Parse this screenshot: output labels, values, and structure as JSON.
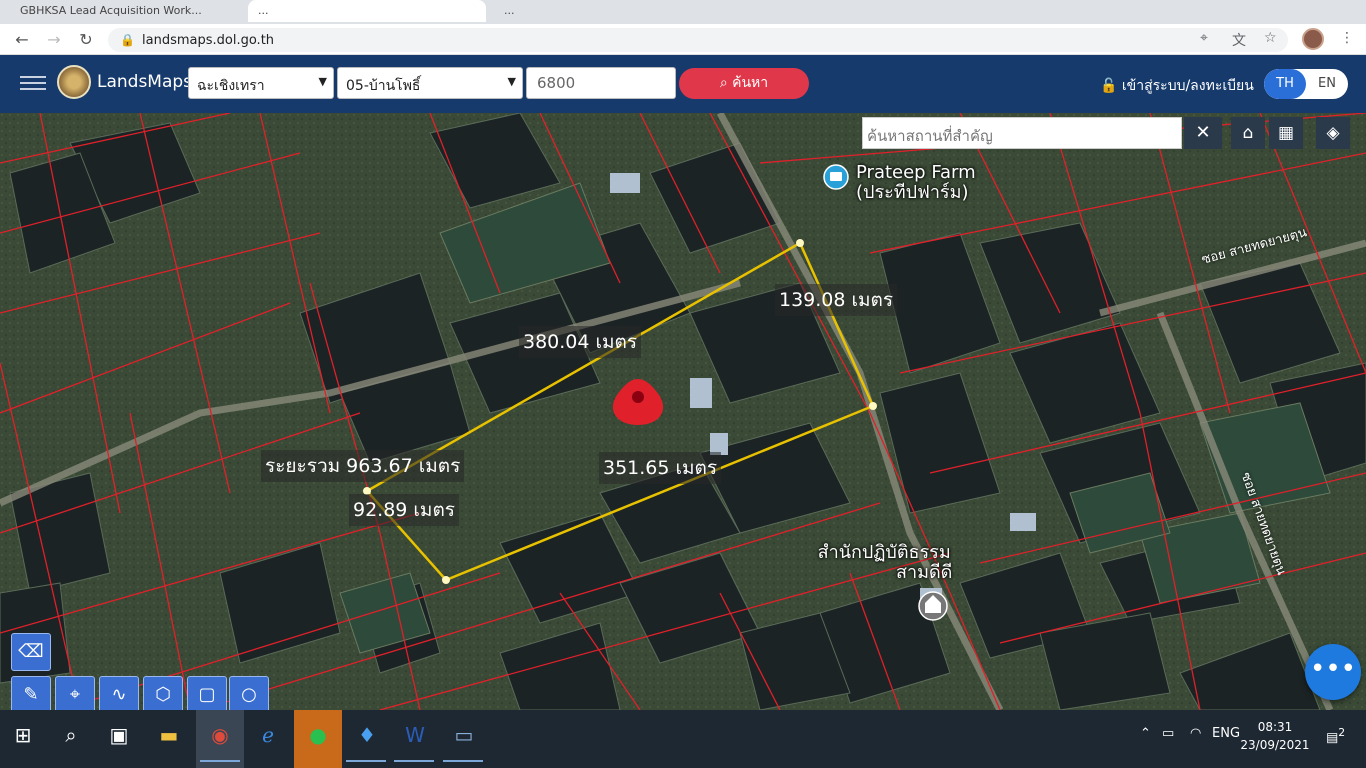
{
  "browser": {
    "url": "landsmaps.dol.go.th",
    "tabs": [
      {
        "label": "GBHKSA Lead Acquisition Work..."
      },
      {
        "label": "..."
      },
      {
        "label": "..."
      }
    ]
  },
  "header": {
    "brand": "LandsMaps",
    "province_select": "ฉะเชิงเทรา",
    "district_select": "05-บ้านโพธิ์",
    "parcel_number": "6800",
    "search_label": "ค้นหา",
    "login_label": "เข้าสู่ระบบ/ลงทะเบียน",
    "lang_th": "TH",
    "lang_en": "EN"
  },
  "map": {
    "place_search_placeholder": "ค้นหาสถานที่สำคัญ",
    "close_label": "✕",
    "labels": {
      "side_top": "380.04 เมตร",
      "side_right": "139.08 เมตร",
      "side_bottom": "351.65 เมตร",
      "side_left": "92.89 เมตร",
      "total": "ระยะรวม 963.67 เมตร"
    },
    "poi": {
      "farm_en": "Prateep Farm",
      "farm_th": "(ประทีปฟาร์ม)",
      "temple_line1": "สำนักปฏิบัติธรรม",
      "temple_line2": "สามดีดี",
      "road1": "ซอย สายทดยายตุน",
      "road2": "ซอย สายทดยายตุน"
    }
  },
  "taskbar": {
    "lang": "ENG",
    "time": "08:31",
    "date": "23/09/2021",
    "notif_count": "2"
  }
}
